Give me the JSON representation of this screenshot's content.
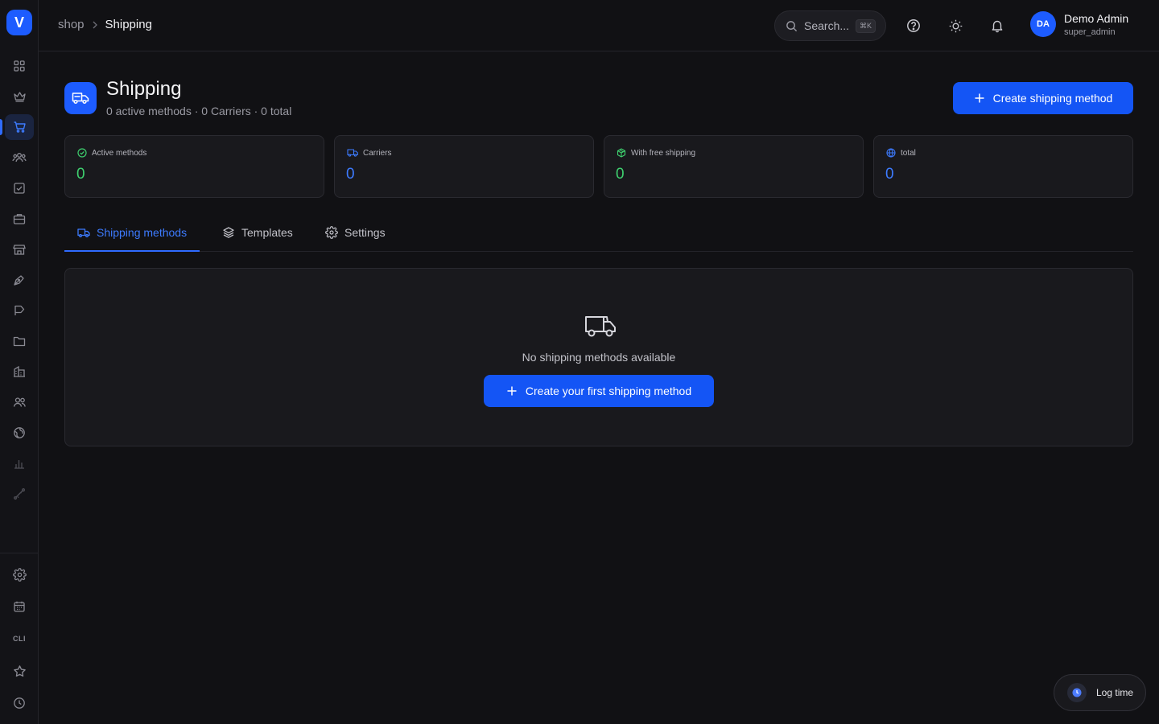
{
  "app": {
    "logo_letter": "V",
    "accent": "#1d5cff"
  },
  "sidebar": {
    "items": [
      {
        "name": "dashboard",
        "icon": "grid-icon"
      },
      {
        "name": "crown",
        "icon": "crown-icon"
      },
      {
        "name": "shop",
        "icon": "cart-icon",
        "active": true
      },
      {
        "name": "team",
        "icon": "people-icon"
      },
      {
        "name": "tasks",
        "icon": "checkbox-icon"
      },
      {
        "name": "briefcase",
        "icon": "briefcase-icon"
      },
      {
        "name": "store",
        "icon": "store-icon"
      },
      {
        "name": "design",
        "icon": "pen-icon"
      },
      {
        "name": "campaigns",
        "icon": "flag-icon"
      },
      {
        "name": "files",
        "icon": "folder-icon"
      },
      {
        "name": "buildings",
        "icon": "building-icon"
      },
      {
        "name": "users",
        "icon": "users-icon"
      },
      {
        "name": "web",
        "icon": "globe-icon"
      },
      {
        "name": "analytics",
        "icon": "bar-chart-icon"
      },
      {
        "name": "integrations",
        "icon": "route-icon"
      }
    ],
    "bottom_items": [
      {
        "name": "settings",
        "icon": "gear-icon"
      },
      {
        "name": "calendar",
        "icon": "calendar-icon"
      },
      {
        "name": "cli",
        "label": "CLI"
      },
      {
        "name": "favorites",
        "icon": "star-icon"
      },
      {
        "name": "history",
        "icon": "clock-icon"
      }
    ]
  },
  "topbar": {
    "breadcrumb": {
      "root": "shop",
      "separator": "›",
      "current": "Shipping"
    },
    "search": {
      "placeholder": "Search...",
      "shortcut": "⌘K"
    },
    "user": {
      "initials": "DA",
      "name": "Demo Admin",
      "role": "super_admin"
    }
  },
  "page": {
    "title": "Shipping",
    "subtitle": "0 active methods · 0 Carriers · 0 total",
    "create_button": "Create shipping method"
  },
  "stats": [
    {
      "label": "Active methods",
      "value": "0",
      "color": "#3ecf6e",
      "icon": "check-circle-icon"
    },
    {
      "label": "Carriers",
      "value": "0",
      "color": "#3d7bff",
      "icon": "truck-icon"
    },
    {
      "label": "With free shipping",
      "value": "0",
      "color": "#3ecf6e",
      "icon": "package-icon"
    },
    {
      "label": "total",
      "value": "0",
      "color": "#3d7bff",
      "icon": "globe-icon"
    }
  ],
  "tabs": [
    {
      "label": "Shipping methods",
      "icon": "truck-icon",
      "active": true
    },
    {
      "label": "Templates",
      "icon": "layers-icon"
    },
    {
      "label": "Settings",
      "icon": "gear-icon"
    }
  ],
  "empty_state": {
    "message": "No shipping methods available",
    "button": "Create your first shipping method"
  },
  "log_time": {
    "label": "Log time"
  }
}
